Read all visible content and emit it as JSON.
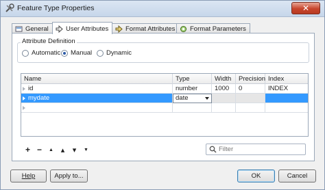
{
  "window": {
    "title": "Feature Type Properties",
    "close_label": "✕"
  },
  "tabs": [
    {
      "label": "General",
      "icon": "general-settings-icon"
    },
    {
      "label": "User Attributes",
      "icon": "user-attributes-icon"
    },
    {
      "label": "Format Attributes",
      "icon": "format-attributes-icon"
    },
    {
      "label": "Format Parameters",
      "icon": "format-parameters-icon"
    }
  ],
  "attribute_definition": {
    "title": "Attribute Definition",
    "options": [
      "Automatic",
      "Manual",
      "Dynamic"
    ],
    "selected": "Manual"
  },
  "grid": {
    "columns": [
      "Name",
      "Type",
      "Width",
      "Precision",
      "Index"
    ],
    "rows": [
      {
        "name": "id",
        "type": "number",
        "width": "1000",
        "precision": "0",
        "index": "INDEX"
      },
      {
        "name": "mydate",
        "type": "date",
        "width": "",
        "precision": "",
        "index": ""
      },
      {
        "name": "",
        "type": "",
        "width": "",
        "precision": "",
        "index": ""
      }
    ],
    "selected_row": 1
  },
  "toolbar": {
    "add": "+",
    "remove": "−",
    "move_top": "▲",
    "move_up": "▴",
    "move_down": "▾",
    "move_bottom": "▼"
  },
  "filter": {
    "placeholder": "Filter"
  },
  "buttons": {
    "help": "Help",
    "apply": "Apply to...",
    "ok": "OK",
    "cancel": "Cancel"
  },
  "colors": {
    "selection": "#3399ff",
    "title_bar": "#c6d6ea",
    "close": "#c7452c"
  }
}
